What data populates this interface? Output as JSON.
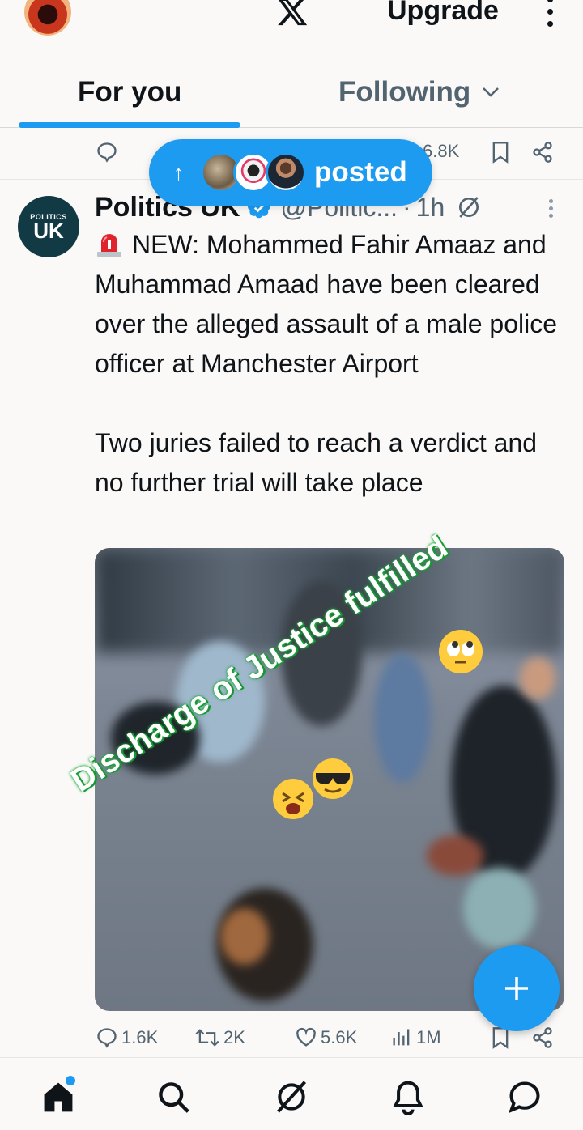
{
  "topbar": {
    "upgrade_label": "Upgrade"
  },
  "tabs": [
    {
      "label": "For you",
      "active": true
    },
    {
      "label": "Following",
      "active": false
    }
  ],
  "previous_tweet": {
    "views_partial": "6.8K"
  },
  "new_posts_pill": {
    "label": "posted"
  },
  "tweet": {
    "author_name": "Politics UK",
    "handle": "@Politic...",
    "time": "1h",
    "avatar_text_small": "POLITICS",
    "avatar_text_big": "UK",
    "text_line1": "NEW: Mohammed Fahir Amaaz and Muhammad Amaad have been cleared over the alleged assault of a male police officer at Manchester Airport",
    "text_line2": "Two juries failed to reach a verdict and no further trial will take place",
    "media_overlay": "Discharge of Justice fulfilled",
    "replies": "1.6K",
    "reposts": "2K",
    "likes": "5.6K",
    "views": "1M"
  },
  "colors": {
    "accent": "#1d9bf0",
    "text_primary": "#0f1419",
    "text_secondary": "#536471",
    "background": "#faf9f8"
  },
  "bottom_nav": [
    {
      "icon": "home-icon",
      "active": true
    },
    {
      "icon": "search-icon"
    },
    {
      "icon": "grok-icon"
    },
    {
      "icon": "bell-icon"
    },
    {
      "icon": "messages-icon"
    }
  ]
}
